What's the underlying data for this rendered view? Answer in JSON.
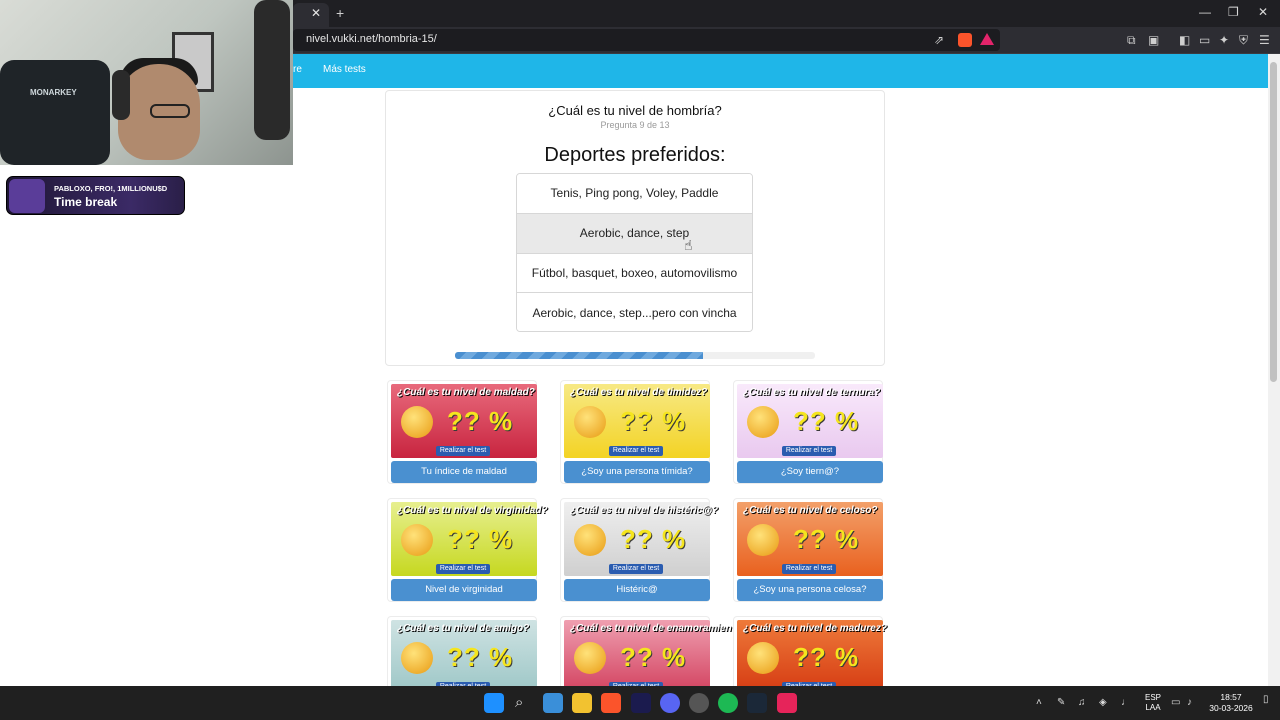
{
  "browser": {
    "url": "nivel.vukki.net/hombria-15/",
    "tab_close": "✕",
    "new_tab": "+"
  },
  "site_nav": {
    "partial_link": "re",
    "more_tests": "Más tests"
  },
  "quiz": {
    "title": "¿Cuál es tu nivel de hombría?",
    "progress_text": "Pregunta 9 de 13",
    "progress_fraction": 0.69,
    "question": "Deportes preferidos:",
    "options": [
      "Tenis, Ping pong, Voley, Paddle",
      "Aerobic, dance, step",
      "Fútbol, basquet, boxeo, automovilismo",
      "Aerobic, dance, step...pero con vincha"
    ],
    "hovered_option_index": 1
  },
  "tests": [
    {
      "banner": "¿Cuál es tu nivel de maldad?",
      "pct": "?? %",
      "button": "Realizar el test",
      "caption": "Tu índice de maldad",
      "colors": [
        "#c8243f",
        "#e86a7c"
      ]
    },
    {
      "banner": "¿Cuál es tu nivel de timidez?",
      "pct": "?? %",
      "button": "Realizar el test",
      "caption": "¿Soy una persona tímida?",
      "colors": [
        "#f3d324",
        "#f7e985"
      ]
    },
    {
      "banner": "¿Cuál es tu nivel de ternura?",
      "pct": "?? %",
      "button": "Realizar el test",
      "caption": "¿Soy tiern@?",
      "colors": [
        "#e9c9ef",
        "#f9e9fb"
      ]
    },
    {
      "banner": "¿Cuál es tu nivel de virginidad?",
      "pct": "?? %",
      "button": "Realizar el test",
      "caption": "Nivel de virginidad",
      "colors": [
        "#c6d820",
        "#e7ef8f"
      ]
    },
    {
      "banner": "¿Cuál es tu nivel de histéric@?",
      "pct": "?? %",
      "button": "Realizar el test",
      "caption": "Histéric@",
      "colors": [
        "#cfcfcf",
        "#efefef"
      ]
    },
    {
      "banner": "¿Cuál es tu nivel de celoso?",
      "pct": "?? %",
      "button": "Realizar el test",
      "caption": "¿Soy una persona celosa?",
      "colors": [
        "#e9611f",
        "#f3a06a"
      ]
    },
    {
      "banner": "¿Cuál es tu nivel de amigo?",
      "pct": "?? %",
      "button": "Realizar el test",
      "caption": "",
      "colors": [
        "#9cc6c6",
        "#cfe3e3"
      ]
    },
    {
      "banner": "¿Cuál es tu nivel de enamoramiento?",
      "pct": "?? %",
      "button": "Realizar el test",
      "caption": "",
      "colors": [
        "#d2405e",
        "#ef9fb0"
      ]
    },
    {
      "banner": "¿Cuál es tu nivel de madurez?",
      "pct": "?? %",
      "button": "Realizar el test",
      "caption": "",
      "colors": [
        "#d53a12",
        "#ee7a3a"
      ]
    }
  ],
  "overlay": {
    "chair_brand": "MONARKEY",
    "alert_names": "PABLOXO, FRO!, 1MILLIONU$D",
    "alert_message": "Time break"
  },
  "taskbar": {
    "lang_1": "ESP",
    "lang_2": "LAA",
    "time": "18:57",
    "date": "30-03-2026"
  }
}
